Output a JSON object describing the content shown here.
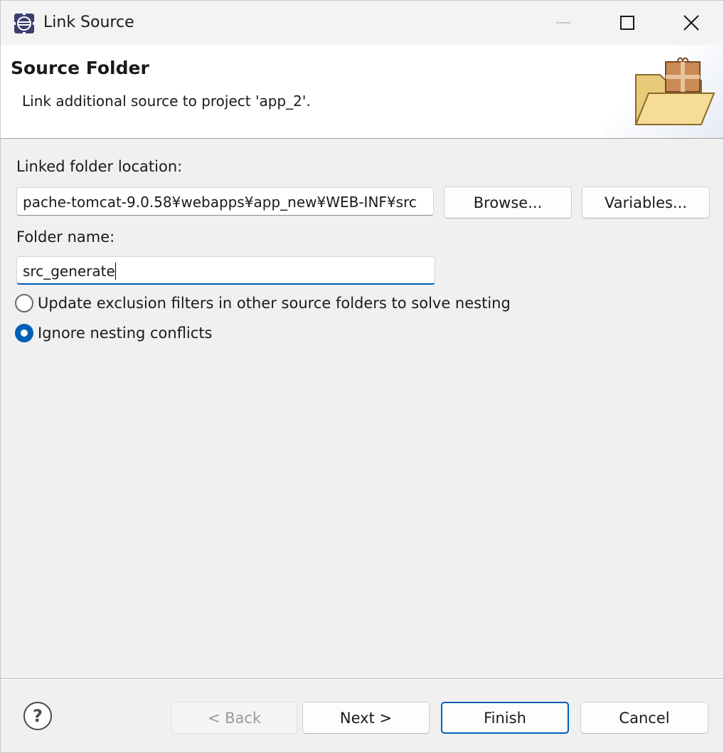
{
  "window": {
    "title": "Link Source",
    "minimize_icon": "minimize-icon",
    "maximize_icon": "maximize-icon",
    "close_icon": "close-icon"
  },
  "banner": {
    "title": "Source Folder",
    "description": "Link additional source to project 'app_2'.",
    "icon": "folder-package-icon"
  },
  "form": {
    "location_label": "Linked folder location:",
    "location_value": "pache-tomcat-9.0.58¥webapps¥app_new¥WEB-INF¥src",
    "browse_label": "Browse...",
    "variables_label": "Variables...",
    "folder_name_label": "Folder name:",
    "folder_name_value": "src_generate",
    "options": [
      {
        "label": "Update exclusion filters in other source folders to solve nesting",
        "checked": false
      },
      {
        "label": "Ignore nesting conflicts",
        "checked": true
      }
    ]
  },
  "footer": {
    "help_icon": "help-icon",
    "back_label": "< Back",
    "next_label": "Next >",
    "finish_label": "Finish",
    "cancel_label": "Cancel"
  },
  "colors": {
    "accent": "#005fb8",
    "background": "#f0f0f0"
  }
}
